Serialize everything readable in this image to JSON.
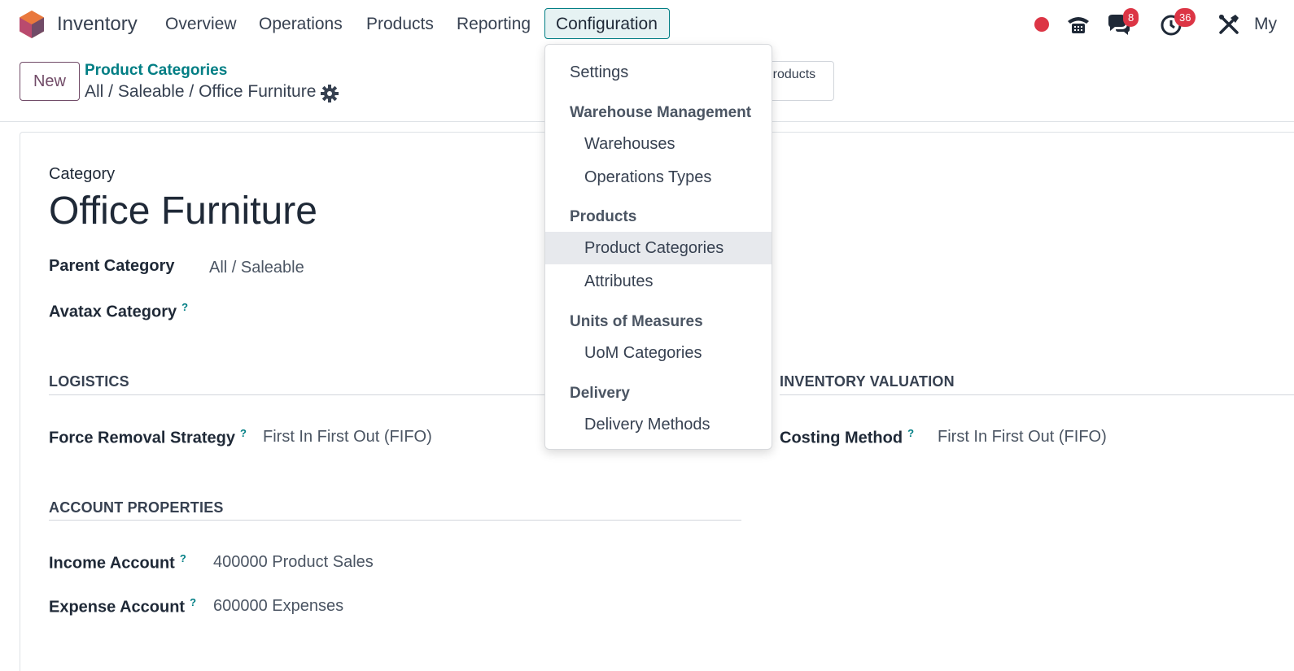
{
  "app": {
    "name": "Inventory",
    "brand_color": "#714b67",
    "accent_color": "#017e84"
  },
  "nav": {
    "overview": "Overview",
    "operations": "Operations",
    "products": "Products",
    "reporting": "Reporting",
    "configuration": "Configuration"
  },
  "systray": {
    "discuss_badge": "8",
    "activity_badge": "36",
    "user_label": "My"
  },
  "control": {
    "new_label": "New",
    "breadcrumb_parent": "Product Categories",
    "breadcrumb_current": "All / Saleable / Office Furniture",
    "smart_button_label": "Products"
  },
  "form": {
    "category_label": "Category",
    "name": "Office Furniture",
    "parent_label": "Parent Category",
    "parent_value": "All / Saleable",
    "avatax_label": "Avatax Category",
    "help_mark": "?",
    "logistics_title": "LOGISTICS",
    "removal_label": "Force Removal Strategy",
    "removal_value": "First In First Out (FIFO)",
    "valuation_title": "INVENTORY VALUATION",
    "costing_label": "Costing Method",
    "costing_value": "First In First Out (FIFO)",
    "account_title": "ACCOUNT PROPERTIES",
    "income_label": "Income Account",
    "income_value": "400000 Product Sales",
    "expense_label": "Expense Account",
    "expense_value": "600000 Expenses"
  },
  "dropdown": {
    "settings": "Settings",
    "warehouse_header": "Warehouse Management",
    "warehouses": "Warehouses",
    "operation_types": "Operations Types",
    "products_header": "Products",
    "product_categories": "Product Categories",
    "attributes": "Attributes",
    "uom_header": "Units of Measures",
    "uom_categories": "UoM Categories",
    "delivery_header": "Delivery",
    "delivery_methods": "Delivery Methods"
  }
}
